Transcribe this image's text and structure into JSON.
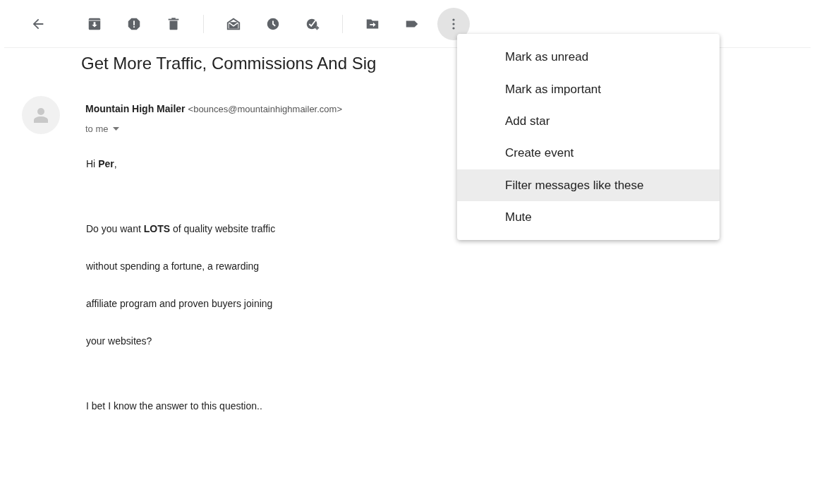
{
  "more_menu": {
    "open": true,
    "items": [
      {
        "label": "Mark as unread",
        "highlighted": false
      },
      {
        "label": "Mark as important",
        "highlighted": false
      },
      {
        "label": "Add star",
        "highlighted": false
      },
      {
        "label": "Create event",
        "highlighted": false
      },
      {
        "label": "Filter messages like these",
        "highlighted": true
      },
      {
        "label": "Mute",
        "highlighted": false
      }
    ]
  },
  "message": {
    "subject": "Get More Traffic, Commissions And Sig",
    "sender_name": "Mountain High Mailer",
    "sender_email": "<bounces@mountainhighmailer.com>",
    "recipient": "to me",
    "body_sections": [
      [
        "Hi **Per**,"
      ],
      [
        "Do you want **LOTS** of quality website traffic",
        "without spending a fortune, a rewarding",
        "affiliate program and proven buyers joining",
        "your websites?"
      ],
      [
        "I bet I know the answer to this question.."
      ]
    ]
  }
}
